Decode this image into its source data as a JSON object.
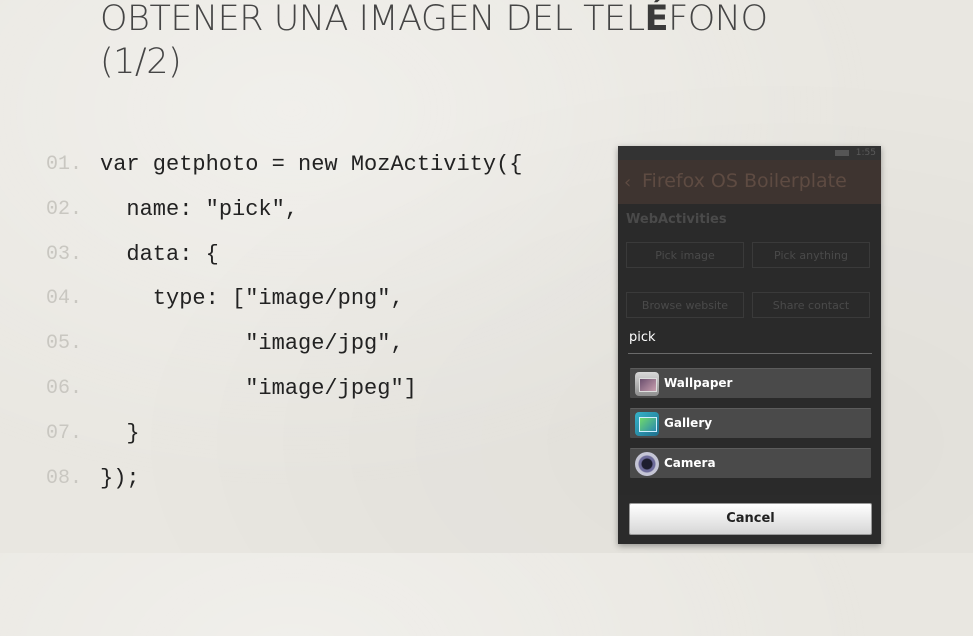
{
  "slide": {
    "title_before": "OBTENER UNA IMAGEN DEL TEL",
    "title_accent": "É",
    "title_after": "FONO",
    "title_line2": "(1/2)"
  },
  "code": {
    "lines": [
      {
        "number": "01.",
        "text": "var getphoto = new MozActivity({"
      },
      {
        "number": "02.",
        "text": "  name: \"pick\","
      },
      {
        "number": "03.",
        "text": "  data: {"
      },
      {
        "number": "04.",
        "text": "    type: [\"image/png\","
      },
      {
        "number": "05.",
        "text": "           \"image/jpg\","
      },
      {
        "number": "06.",
        "text": "           \"image/jpeg\"]"
      },
      {
        "number": "07.",
        "text": "  }"
      },
      {
        "number": "08.",
        "text": "});"
      }
    ]
  },
  "phone": {
    "status_time": "1:55",
    "app_title": "Firefox OS Boilerplate",
    "section_label": "WebActivities",
    "background_buttons": [
      "Pick image",
      "Pick anything",
      "Browse website",
      "Share contact"
    ],
    "dialog": {
      "title": "pick",
      "options": [
        {
          "label": "Wallpaper",
          "icon": "wallpaper-icon"
        },
        {
          "label": "Gallery",
          "icon": "gallery-icon"
        },
        {
          "label": "Camera",
          "icon": "camera-icon"
        }
      ],
      "cancel_label": "Cancel"
    }
  }
}
